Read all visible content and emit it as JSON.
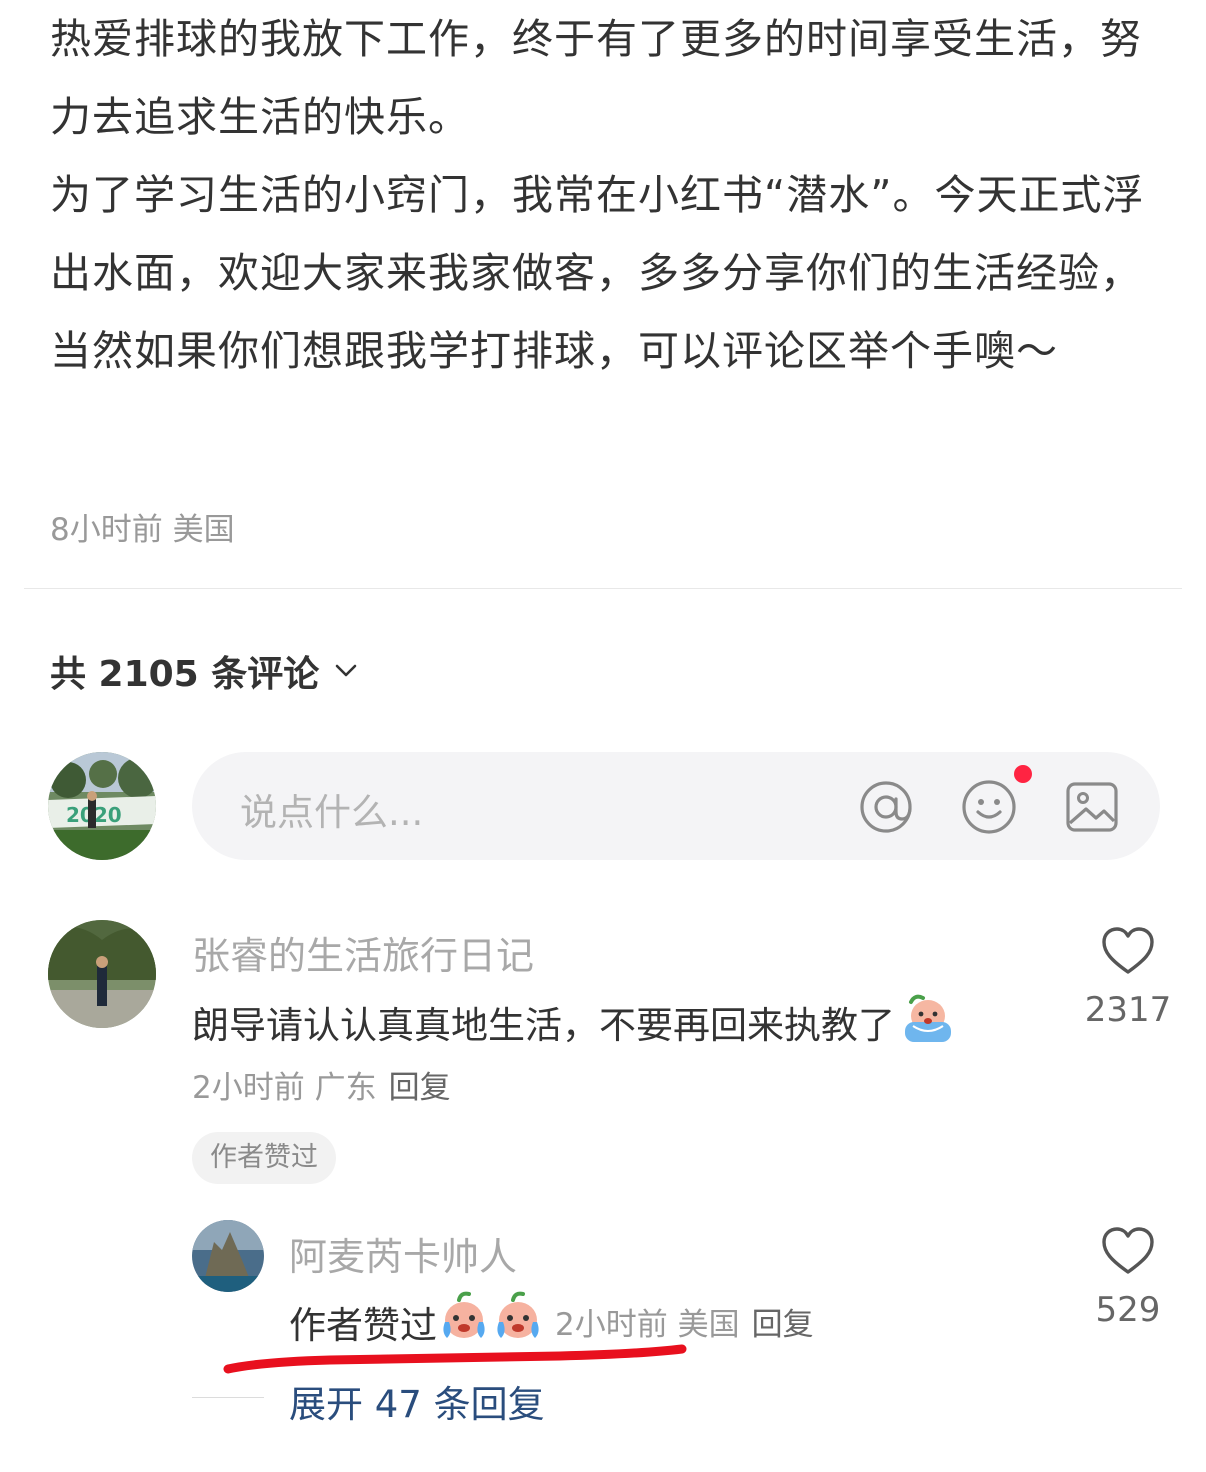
{
  "post": {
    "paragraphs": [
      "热爱排球的我放下工作，终于有了更多的时间享受生活，努力去追求生活的快乐。",
      "为了学习生活的小窍门，我常在小红书“潜水”。今天正式浮出水面，欢迎大家来我家做客，多多分享你们的生活经验，当然如果你们想跟我学打排球，可以评论区举个手噢～"
    ],
    "meta": "8小时前 美国"
  },
  "comments_header": {
    "label": "共 2105 条评论"
  },
  "input": {
    "placeholder": "说点什么..."
  },
  "comments": [
    {
      "username": "张睿的生活旅行日记",
      "text": "朗导请认认真真地生活，不要再回来执教了",
      "meta": "2小时前 广东",
      "reply": "回复",
      "badge": "作者赞过",
      "likes": "2317"
    }
  ],
  "sub_reply": {
    "username": "阿麦芮卡帅人",
    "text": "作者赞过",
    "meta": "2小时前 美国",
    "reply": "回复",
    "likes": "529"
  },
  "expand": {
    "label": "展开 47 条回复"
  },
  "colors": {
    "accent_red": "#ff2442",
    "link_blue": "#2a4d7d",
    "underline_red": "#e8101e"
  }
}
